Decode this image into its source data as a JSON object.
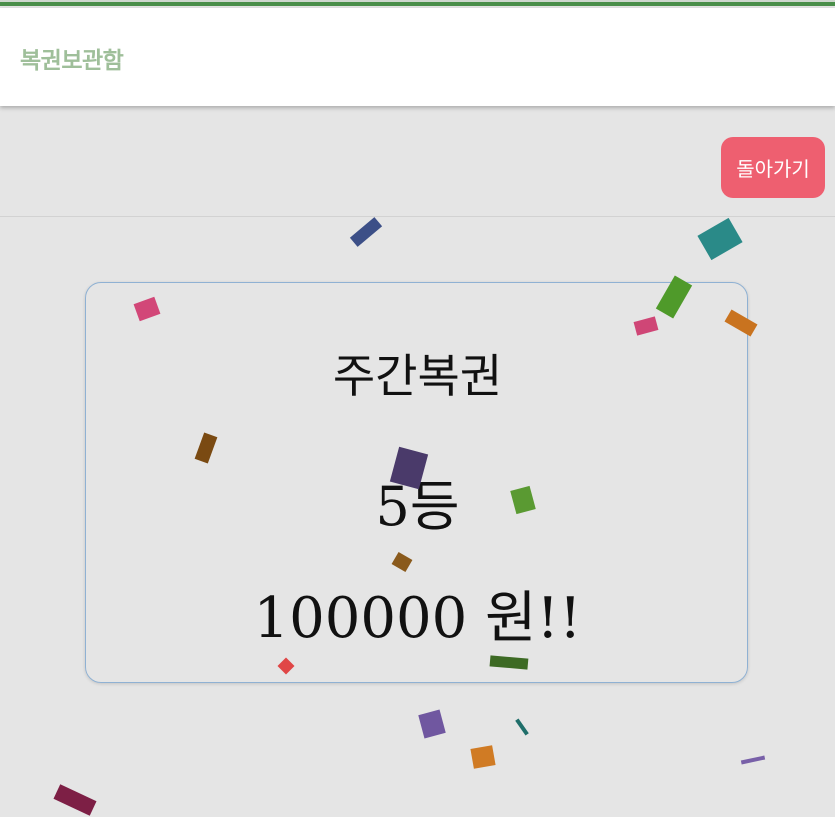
{
  "header": {
    "title": "복권보관함"
  },
  "actions": {
    "back_label": "돌아가기"
  },
  "result": {
    "lottery_type": "주간복권",
    "rank": "5등",
    "prize": "100000 원!!"
  },
  "colors": {
    "accent_green": "#4a8f4a",
    "header_title": "#9fbf9a",
    "back_button": "#ee5f70",
    "ticket_border": "#8fb1d3",
    "background": "#e5e5e5"
  }
}
